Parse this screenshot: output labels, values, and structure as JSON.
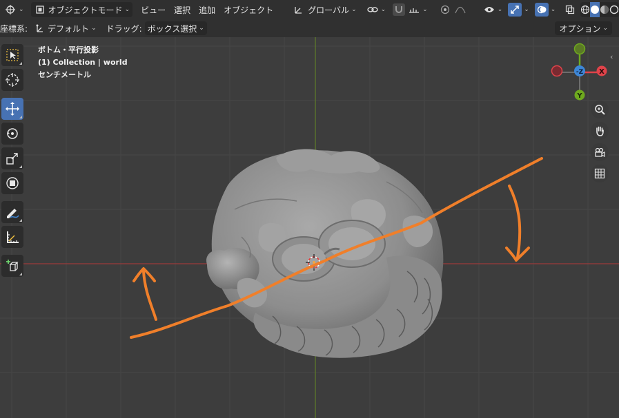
{
  "header": {
    "mode_label": "オブジェクトモード",
    "menus": [
      "ビュー",
      "選択",
      "追加",
      "オブジェクト"
    ],
    "transform_orientation": "グローバル"
  },
  "subbar": {
    "coord_label": "座標系:",
    "coord_value": "デフォルト",
    "drag_label": "ドラッグ:",
    "drag_value": "ボックス選択",
    "options_label": "オプション"
  },
  "viewport_info": {
    "view_name": "ボトム・平行投影",
    "collection": "(1) Collection | world",
    "units": "センチメートル"
  },
  "gizmo": {
    "x_label": "X",
    "y_label": "Y",
    "z_label": "-Z",
    "x_color": "#e0434a",
    "y_color": "#6ea91f",
    "z_color": "#3d86d6"
  },
  "colors": {
    "accent": "#4772b3",
    "annotation": "#f07f2a",
    "grid_axis_x": "#9c3b3b",
    "grid_axis_y": "#5f7a2b"
  },
  "toolbar": [
    "select-box",
    "cursor",
    "move",
    "rotate",
    "scale",
    "transform",
    "annotate",
    "measure",
    "add-cube"
  ],
  "nav_buttons": [
    "zoom-icon",
    "hand-pan-icon",
    "camera-icon",
    "grid-icon"
  ]
}
